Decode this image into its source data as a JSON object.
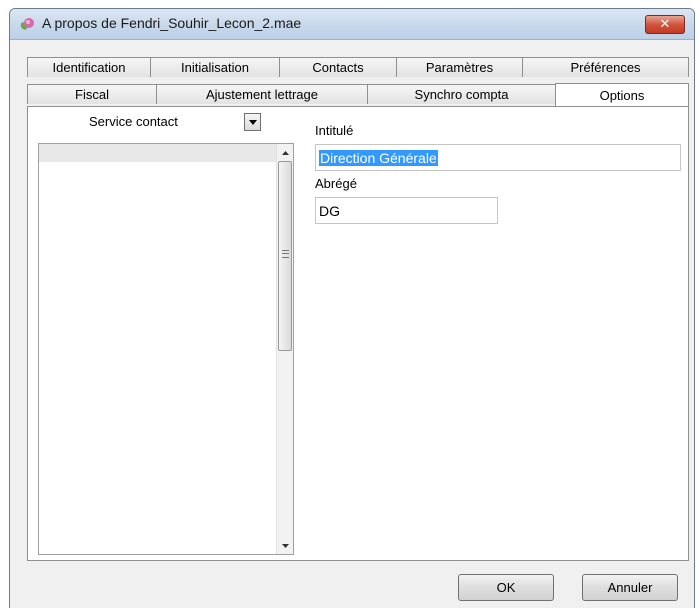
{
  "window": {
    "title": "A propos de Fendri_Souhir_Lecon_2.mae",
    "app_icon": "flower-icon",
    "close_icon": "close-icon",
    "close_color": "#c23a22"
  },
  "tabs_row1": [
    {
      "label": "Identification"
    },
    {
      "label": "Initialisation"
    },
    {
      "label": "Contacts"
    },
    {
      "label": "Paramètres"
    },
    {
      "label": "Préférences"
    }
  ],
  "tabs_row2": [
    {
      "label": "Fiscal"
    },
    {
      "label": "Ajustement lettrage"
    },
    {
      "label": "Synchro compta"
    },
    {
      "label": "Options",
      "active": true
    }
  ],
  "options": {
    "dropdown": {
      "selected": "Service contact"
    },
    "intitule": {
      "label": "Intitulé",
      "value": "Direction Générale"
    },
    "abrege": {
      "label": "Abrégé",
      "value": "DG"
    }
  },
  "buttons": {
    "ok": "OK",
    "cancel": "Annuler"
  },
  "colors": {
    "selection": "#3399ff",
    "titlebar": "#c6d7ea"
  }
}
